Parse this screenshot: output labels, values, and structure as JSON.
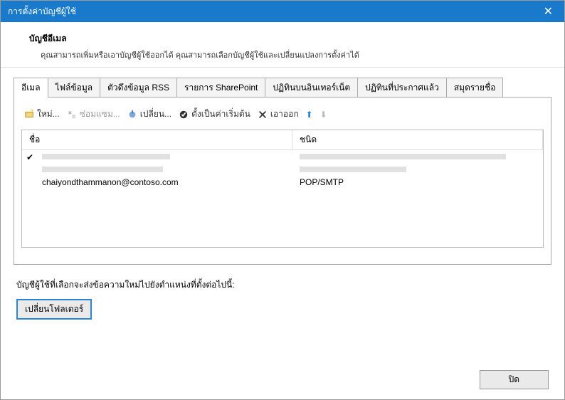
{
  "titlebar": {
    "title": "การตั้งค่าบัญชีผู้ใช้",
    "close": "✕"
  },
  "header": {
    "title": "บัญชีอีเมล",
    "desc": "คุณสามารถเพิ่มหรือเอาบัญชีผู้ใช้ออกได้ คุณสามารถเลือกบัญชีผู้ใช้และเปลี่ยนแปลงการตั้งค่าได้"
  },
  "tabs": {
    "email": "อีเมล",
    "datafiles": "ไฟล์ข้อมูล",
    "rss": "ตัวดึงข้อมูล RSS",
    "sharepoint": "รายการ SharePoint",
    "internetcal": "ปฏิทินบนอินเทอร์เน็ต",
    "publishedcal": "ปฏิทินที่ประกาศแล้ว",
    "addressbooks": "สมุดรายชื่อ"
  },
  "toolbar": {
    "new": "ใหม่...",
    "repair": "ซ่อมแซม...",
    "change": "เปลี่ยน...",
    "setdefault": "ตั้งเป็นค่าเริ่มต้น",
    "remove": "เอาออก"
  },
  "columns": {
    "name": "ชื่อ",
    "type": "ชนิด"
  },
  "rows": {
    "account_email": "chaiyondthammanon@contoso.com",
    "account_type": "POP/SMTP"
  },
  "below": {
    "text": "บัญชีผู้ใช้ที่เลือกจะส่งข้อความใหม่ไปยังตำแหน่งที่ตั้งต่อไปนี้:",
    "change_folder": "เปลี่ยนโฟลเดอร์"
  },
  "footer": {
    "close": "ปิด"
  }
}
